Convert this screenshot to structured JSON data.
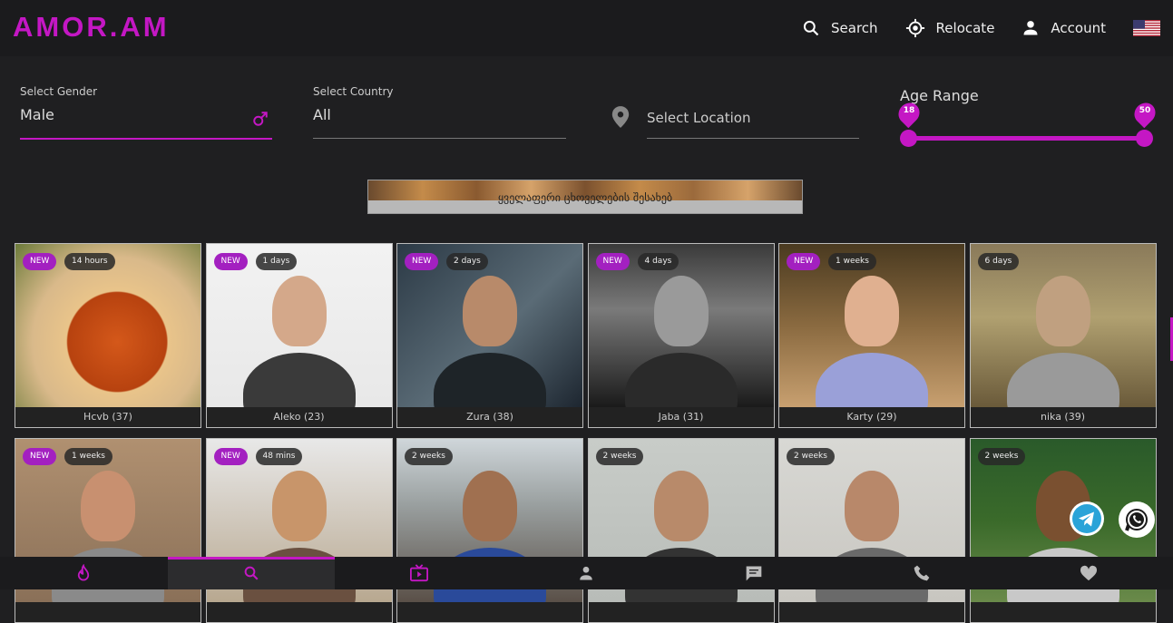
{
  "brand": {
    "logo": "AMOR.AM",
    "accent": "#c417c4"
  },
  "nav": {
    "search_label": "Search",
    "relocate_label": "Relocate",
    "account_label": "Account",
    "language_flag": "us-flag-icon"
  },
  "filters": {
    "gender": {
      "label": "Select Gender",
      "value": "Male",
      "icon": "male-icon"
    },
    "country": {
      "label": "Select Country",
      "value": "All"
    },
    "location": {
      "placeholder": "Select Location",
      "icon": "location-pin-icon"
    },
    "age_range": {
      "label": "Age Range",
      "min": 18,
      "max": 50,
      "min_label": "18",
      "max_label": "50"
    }
  },
  "banner": {
    "text": "ყველაფერი ცხოველების შესახებ"
  },
  "profiles": [
    {
      "name": "Hcvb (37)",
      "new": "NEW",
      "time": "14 hours"
    },
    {
      "name": "Aleko (23)",
      "new": "NEW",
      "time": "1 days"
    },
    {
      "name": "Zura (38)",
      "new": "NEW",
      "time": "2 days"
    },
    {
      "name": "Jaba (31)",
      "new": "NEW",
      "time": "4 days"
    },
    {
      "name": "Karty (29)",
      "new": "NEW",
      "time": "1 weeks"
    },
    {
      "name": "nika (39)",
      "new": "",
      "time": "6 days"
    },
    {
      "name": "",
      "new": "NEW",
      "time": "1 weeks"
    },
    {
      "name": "",
      "new": "NEW",
      "time": "48 mins"
    },
    {
      "name": "",
      "new": "",
      "time": "2 weeks"
    },
    {
      "name": "",
      "new": "",
      "time": "2 weeks"
    },
    {
      "name": "",
      "new": "",
      "time": "2 weeks"
    },
    {
      "name": "",
      "new": "",
      "time": "2 weeks"
    }
  ],
  "bottom_nav": [
    "flame-icon",
    "search-icon",
    "live-tv-icon",
    "person-icon",
    "chat-icon",
    "phone-icon",
    "heart-icon"
  ],
  "floating": [
    "telegram-icon",
    "whatsapp-icon"
  ]
}
